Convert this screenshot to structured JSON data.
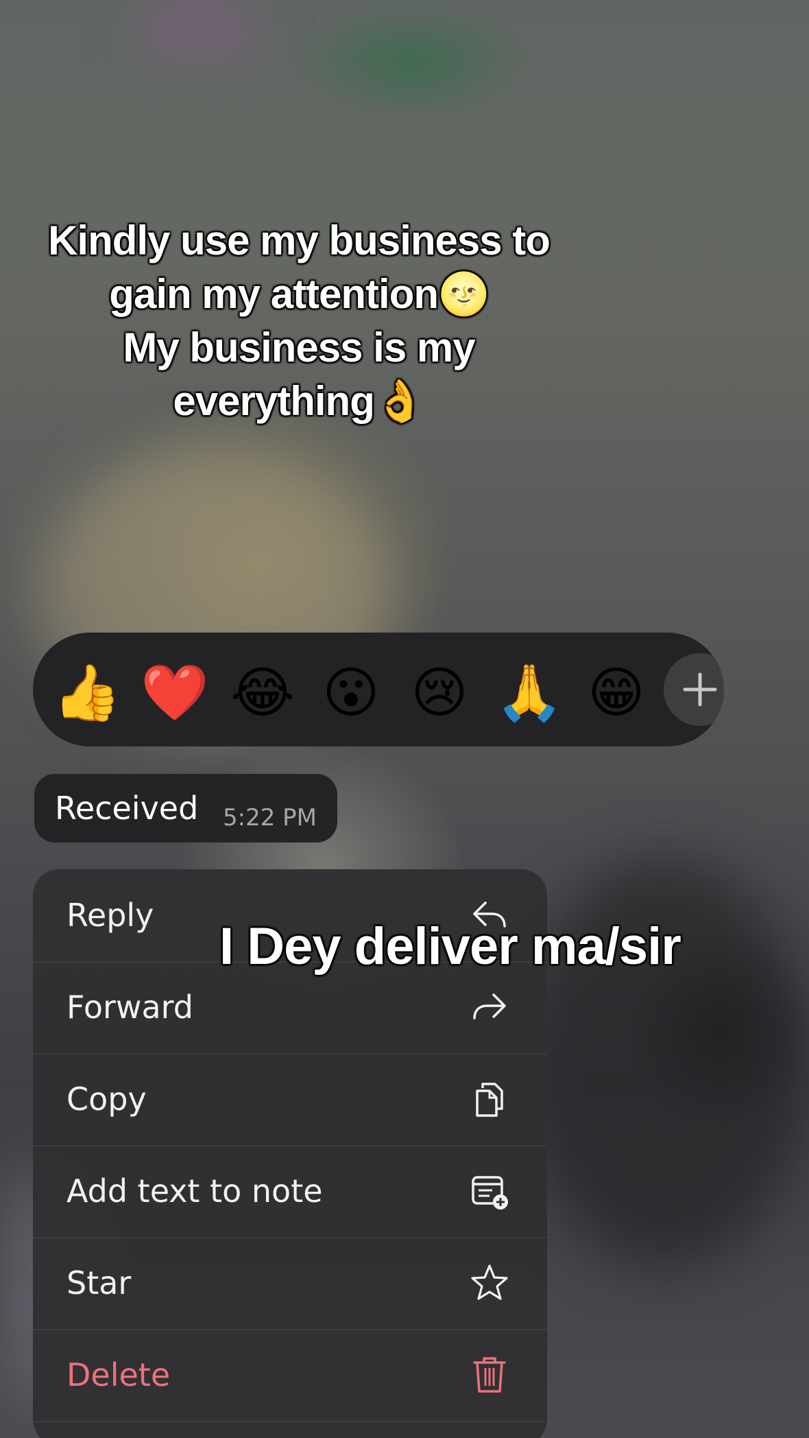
{
  "overlay_captions": {
    "top_lines": [
      "Kindly use my business to",
      "gain my attention🌝",
      "My business is my",
      "everything👌"
    ],
    "middle": "I Dey deliver ma/sir"
  },
  "reactions": {
    "emojis": [
      "👍",
      "❤️",
      "😂",
      "😮",
      "😢",
      "🙏",
      "😁"
    ],
    "more_icon": "plus-icon"
  },
  "message": {
    "text": "Received",
    "time": "5:22 PM"
  },
  "context_menu": {
    "items": [
      {
        "label": "Reply",
        "icon": "reply-icon"
      },
      {
        "label": "Forward",
        "icon": "forward-icon"
      },
      {
        "label": "Copy",
        "icon": "copy-icon"
      },
      {
        "label": "Add text to note",
        "icon": "add-note-icon"
      },
      {
        "label": "Star",
        "icon": "star-icon"
      },
      {
        "label": "Delete",
        "icon": "trash-icon",
        "destructive": true
      }
    ],
    "destructive_color": "#f0707c"
  }
}
